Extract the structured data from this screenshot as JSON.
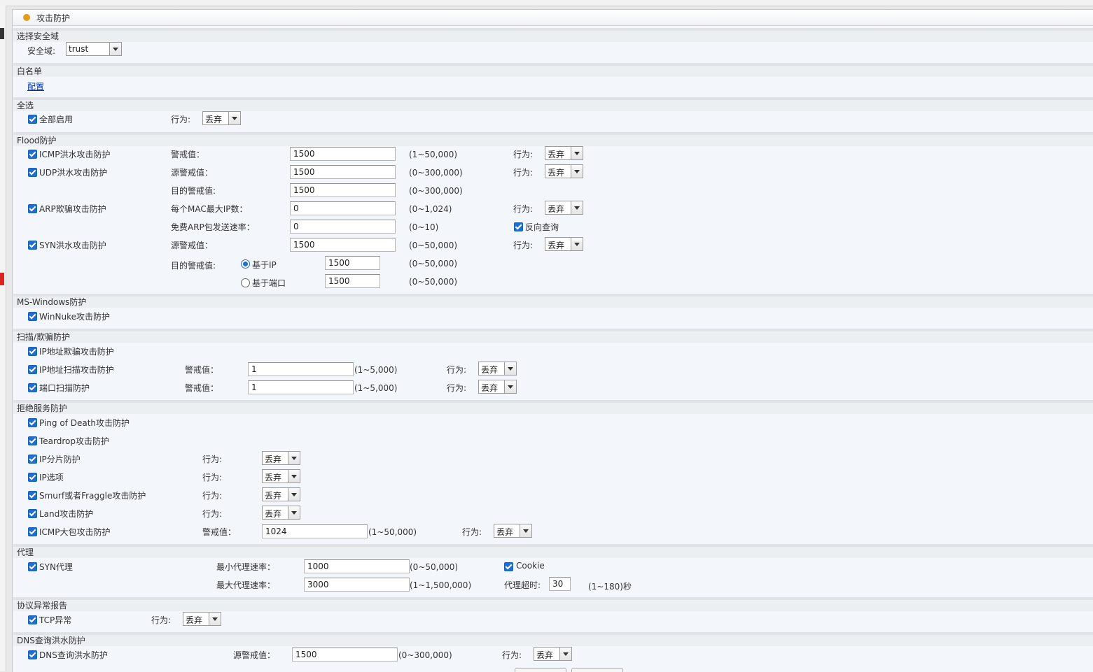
{
  "window_title": "攻击防护",
  "sections": {
    "zone": "选择安全域",
    "whitelist": "白名单",
    "select_all": "全选",
    "flood": "Flood防护",
    "mswin": "MS-Windows防护",
    "scan": "扫描/欺骗防护",
    "dos": "拒绝服务防护",
    "proxy": "代理",
    "proto": "协议异常报告",
    "dns": "DNS查询洪水防护"
  },
  "labels": {
    "zone_label": "安全域:",
    "action": "行为:",
    "threshold": "警戒值：",
    "src_threshold": "源警戒值：",
    "dst_threshold_colon": "目的警戒值:",
    "max_ip_per_mac": "每个MAC最大IP数：",
    "gratuitous_arp_rate": "免费ARP包发送速率：",
    "min_proxy_rate": "最小代理速率：",
    "max_proxy_rate": "最大代理速率：",
    "proxy_timeout": "代理超时:",
    "seconds_unit": "秒"
  },
  "values": {
    "zone": "trust",
    "drop": "丢弃",
    "config_link": "配置",
    "icmp_threshold": "1500",
    "udp_src": "1500",
    "udp_dst": "1500",
    "arp_max_ip": "0",
    "arp_rate": "0",
    "syn_src": "1500",
    "syn_dst_ip": "1500",
    "syn_dst_port": "1500",
    "ip_scan": "1",
    "port_scan": "1",
    "icmp_large": "1024",
    "proxy_min": "1000",
    "proxy_max": "3000",
    "proxy_timeout": "30",
    "dns_src": "1500"
  },
  "checks": {
    "enable_all": "全部启用",
    "icmp_flood": "ICMP洪水攻击防护",
    "udp_flood": "UDP洪水攻击防护",
    "arp_spoof": "ARP欺骗攻击防护",
    "reverse_lookup": "反向查询",
    "syn_flood": "SYN洪水攻击防护",
    "winnuke": "WinNuke攻击防护",
    "ip_spoof": "IP地址欺骗攻击防护",
    "ip_scan": "IP地址扫描攻击防护",
    "port_scan": "端口扫描防护",
    "ping_of_death": "Ping of Death攻击防护",
    "teardrop": "Teardrop攻击防护",
    "ip_fragment": "IP分片防护",
    "ip_option": "IP选项",
    "smurf": "Smurf或者Fraggle攻击防护",
    "land": "Land攻击防护",
    "icmp_large": "ICMP大包攻击防护",
    "syn_proxy": "SYN代理",
    "cookie": "Cookie",
    "tcp_anomaly": "TCP异常",
    "dns_flood": "DNS查询洪水防护"
  },
  "radios": {
    "by_ip": "基于IP",
    "by_port": "基于端口"
  },
  "ranges": {
    "r1_50000": "(1~50,000)",
    "r0_300000": "(0~300,000)",
    "r0_1024": "(0~1,024)",
    "r0_10": "(0~10)",
    "r0_50000": "(0~50,000)",
    "r1_5000": "(1~5,000)",
    "r1_1500000": "(1~1,500,000)",
    "r1_180": "(1~180)"
  }
}
